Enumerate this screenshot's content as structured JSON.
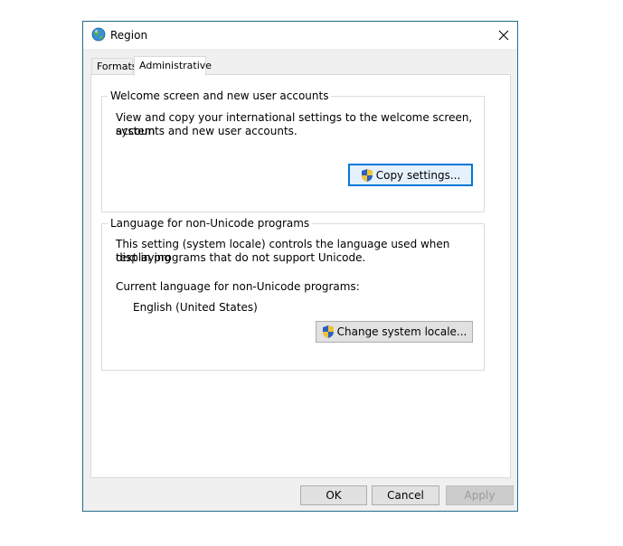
{
  "window": {
    "title": "Region",
    "app_icon": "globe-icon",
    "close_icon": "close-icon"
  },
  "tabs": [
    {
      "label": "Formats",
      "active": false
    },
    {
      "label": "Administrative",
      "active": true
    }
  ],
  "welcome_group": {
    "title": "Welcome screen and new user accounts",
    "description_line1": "View and copy your international settings to the welcome screen, system",
    "description_line2": "accounts and new user accounts.",
    "button_label": "Copy settings...",
    "button_icon": "uac-shield-icon"
  },
  "locale_group": {
    "title": "Language for non-Unicode programs",
    "description_line1": "This setting (system locale) controls the language used when displaying",
    "description_line2": "text in programs that do not support Unicode.",
    "current_label": "Current language for non-Unicode programs:",
    "current_value": "English (United States)",
    "button_label": "Change system locale...",
    "button_icon": "uac-shield-icon"
  },
  "footer": {
    "ok_label": "OK",
    "cancel_label": "Cancel",
    "apply_label": "Apply"
  },
  "colors": {
    "window_border": "#1f6e8c",
    "default_button_border": "#0078d7",
    "dialog_background": "#f0f0f0"
  }
}
